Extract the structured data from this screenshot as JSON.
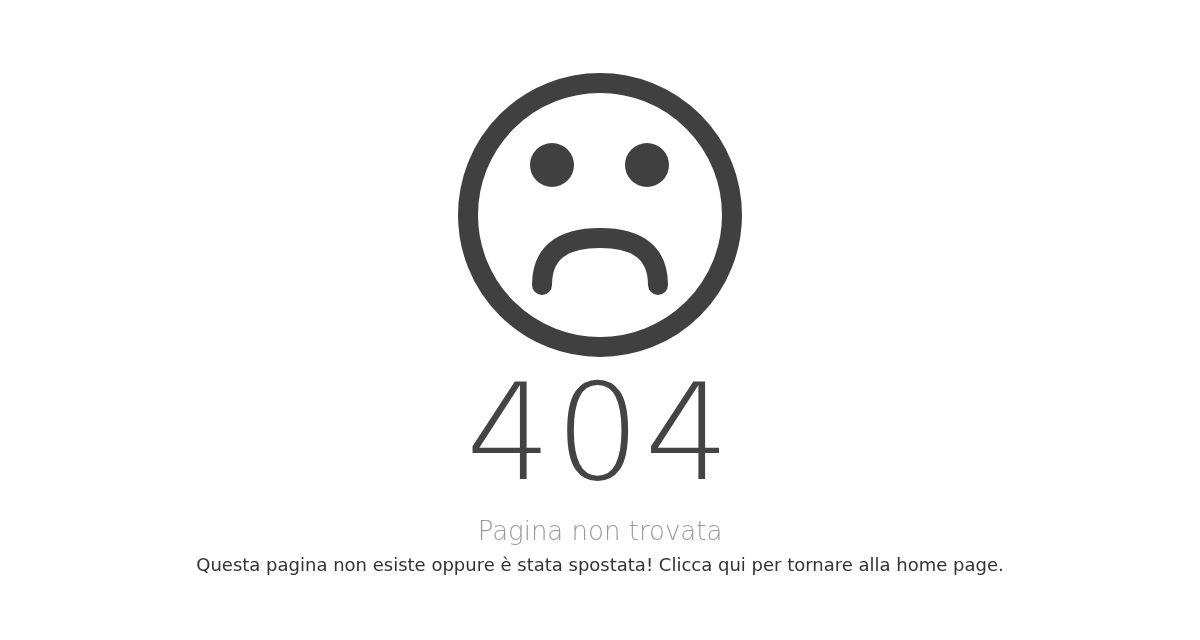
{
  "error": {
    "code": "404",
    "title": "Pagina non trovata",
    "message": "Questa pagina non esiste oppure è stata spostata! Clicca qui per tornare alla home page."
  }
}
